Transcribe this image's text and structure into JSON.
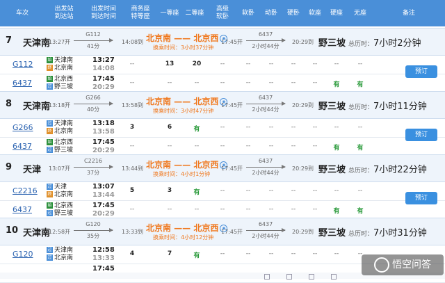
{
  "header": {
    "cols": [
      "车次",
      "出发站\n到达站",
      "出发时间\n到达时间",
      "商务座\n特等座",
      "一等座",
      "二等座",
      "高级\n软卧",
      "软卧",
      "动卧",
      "硬卧",
      "软座",
      "硬座",
      "无座",
      "备注"
    ]
  },
  "groups": [
    {
      "index": "7",
      "from": "天津南",
      "depart": "13:27开",
      "leg1_train": "G112",
      "leg1_duration": "41分",
      "leg1_arrive": "14:08到",
      "route": "北京南 —— 北京西",
      "transfer": "换乘时间：3小时37分钟",
      "leg2_depart": "17:45开",
      "leg2_train": "6437",
      "leg2_duration": "2小时44分",
      "leg2_arrive": "20:29到",
      "to": "野三坡",
      "total_label": "总历时：",
      "total": "7小时2分钟",
      "rows": [
        {
          "code": "G112",
          "st1": "天津南",
          "st2": "北京南",
          "b1": "始",
          "b2": "终",
          "t1": "13:27",
          "t2": "14:08",
          "cells": [
            "--",
            "13",
            "20",
            "--",
            "--",
            "--",
            "--",
            "--",
            "--",
            "--"
          ]
        },
        {
          "code": "6437",
          "st1": "北京西",
          "st2": "野三坡",
          "b1": "始",
          "b2": "过",
          "t1": "17:45",
          "t2": "20:29",
          "cells": [
            "--",
            "--",
            "--",
            "--",
            "--",
            "--",
            "--",
            "--",
            "有",
            "有"
          ]
        }
      ],
      "button": "预订"
    },
    {
      "index": "8",
      "from": "天津南",
      "depart": "13:18开",
      "leg1_train": "G266",
      "leg1_duration": "40分",
      "leg1_arrive": "13:58到",
      "route": "北京南 —— 北京西",
      "transfer": "换乘时间：3小时47分钟",
      "leg2_depart": "17:45开",
      "leg2_train": "6437",
      "leg2_duration": "2小时44分",
      "leg2_arrive": "20:29到",
      "to": "野三坡",
      "total_label": "总历时：",
      "total": "7小时11分钟",
      "rows": [
        {
          "code": "G266",
          "st1": "天津南",
          "st2": "北京南",
          "b1": "过",
          "b2": "终",
          "t1": "13:18",
          "t2": "13:58",
          "cells": [
            "3",
            "6",
            "有",
            "--",
            "--",
            "--",
            "--",
            "--",
            "--",
            "--"
          ]
        },
        {
          "code": "6437",
          "st1": "北京西",
          "st2": "野三坡",
          "b1": "始",
          "b2": "过",
          "t1": "17:45",
          "t2": "20:29",
          "cells": [
            "--",
            "--",
            "--",
            "--",
            "--",
            "--",
            "--",
            "--",
            "有",
            "有"
          ]
        }
      ],
      "button": "预订"
    },
    {
      "index": "9",
      "from": "天津",
      "depart": "13:07开",
      "leg1_train": "C2216",
      "leg1_duration": "37分",
      "leg1_arrive": "13:44到",
      "route": "北京南 —— 北京西",
      "transfer": "换乘时间：4小时1分钟",
      "leg2_depart": "17:45开",
      "leg2_train": "6437",
      "leg2_duration": "2小时44分",
      "leg2_arrive": "20:29到",
      "to": "野三坡",
      "total_label": "总历时：",
      "total": "7小时22分钟",
      "rows": [
        {
          "code": "C2216",
          "st1": "天津",
          "st2": "北京南",
          "b1": "过",
          "b2": "终",
          "t1": "13:07",
          "t2": "13:44",
          "cells": [
            "5",
            "3",
            "有",
            "--",
            "--",
            "--",
            "--",
            "--",
            "--",
            "--"
          ]
        },
        {
          "code": "6437",
          "st1": "北京西",
          "st2": "野三坡",
          "b1": "始",
          "b2": "过",
          "t1": "17:45",
          "t2": "20:29",
          "cells": [
            "--",
            "--",
            "--",
            "--",
            "--",
            "--",
            "--",
            "--",
            "有",
            "有"
          ]
        }
      ],
      "button": "预订"
    },
    {
      "index": "10",
      "from": "天津南",
      "depart": "12:58开",
      "leg1_train": "G120",
      "leg1_duration": "35分",
      "leg1_arrive": "13:33到",
      "route": "北京南 —— 北京西",
      "transfer": "换乘时间：4小时12分钟",
      "leg2_depart": "17:45开",
      "leg2_train": "6437",
      "leg2_duration": "2小时44分",
      "leg2_arrive": "20:29到",
      "to": "野三坡",
      "total_label": "总历时：",
      "total": "7小时31分钟",
      "rows": [
        {
          "code": "G120",
          "st1": "天津南",
          "st2": "北京南",
          "b1": "过",
          "b2": "过",
          "t1": "12:58",
          "t2": "13:33",
          "cells": [
            "4",
            "7",
            "有",
            "--",
            "--",
            "--",
            "--",
            "--",
            "--",
            "--"
          ]
        },
        {
          "code": "",
          "st1": "",
          "st2": "",
          "b1": "",
          "b2": "",
          "t1": "17:45",
          "t2": "",
          "cells": [
            "",
            "",
            "",
            "",
            "",
            "",
            "",
            "",
            "",
            ""
          ]
        }
      ],
      "button": ""
    }
  ],
  "watermark": "悟空问答",
  "colors": {
    "header_bg": "#4a8fd8",
    "accent_orange": "#f0781e",
    "available_green": "#2a9a3a",
    "button_blue": "#3a90e0"
  },
  "icons": [
    "start-badge",
    "end-badge",
    "pass-badge",
    "map-pin-icon"
  ]
}
